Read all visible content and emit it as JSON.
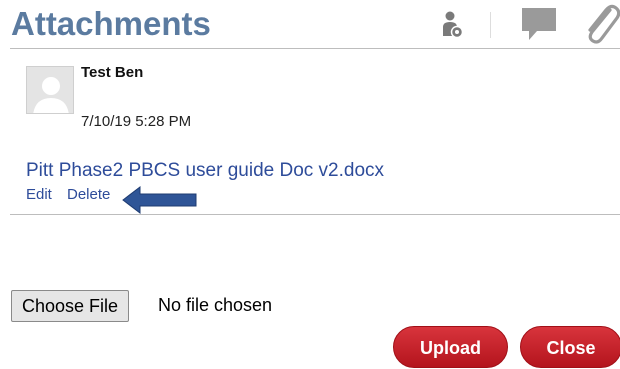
{
  "header": {
    "title": "Attachments",
    "icons": [
      "user-settings-icon",
      "comment-icon",
      "paperclip-icon"
    ]
  },
  "attachment": {
    "author": "Test Ben",
    "timestamp": "7/10/19 5:28 PM",
    "file_name": "Pitt Phase2 PBCS user guide Doc v2.docx",
    "edit_label": "Edit",
    "delete_label": "Delete"
  },
  "upload_form": {
    "choose_file_label": "Choose File",
    "no_file_text": "No file chosen",
    "upload_label": "Upload",
    "close_label": "Close"
  },
  "colors": {
    "title": "#5b7ba0",
    "link": "#2e4c9a",
    "button_red": "#c4222b",
    "arrow": "#2f5597"
  }
}
